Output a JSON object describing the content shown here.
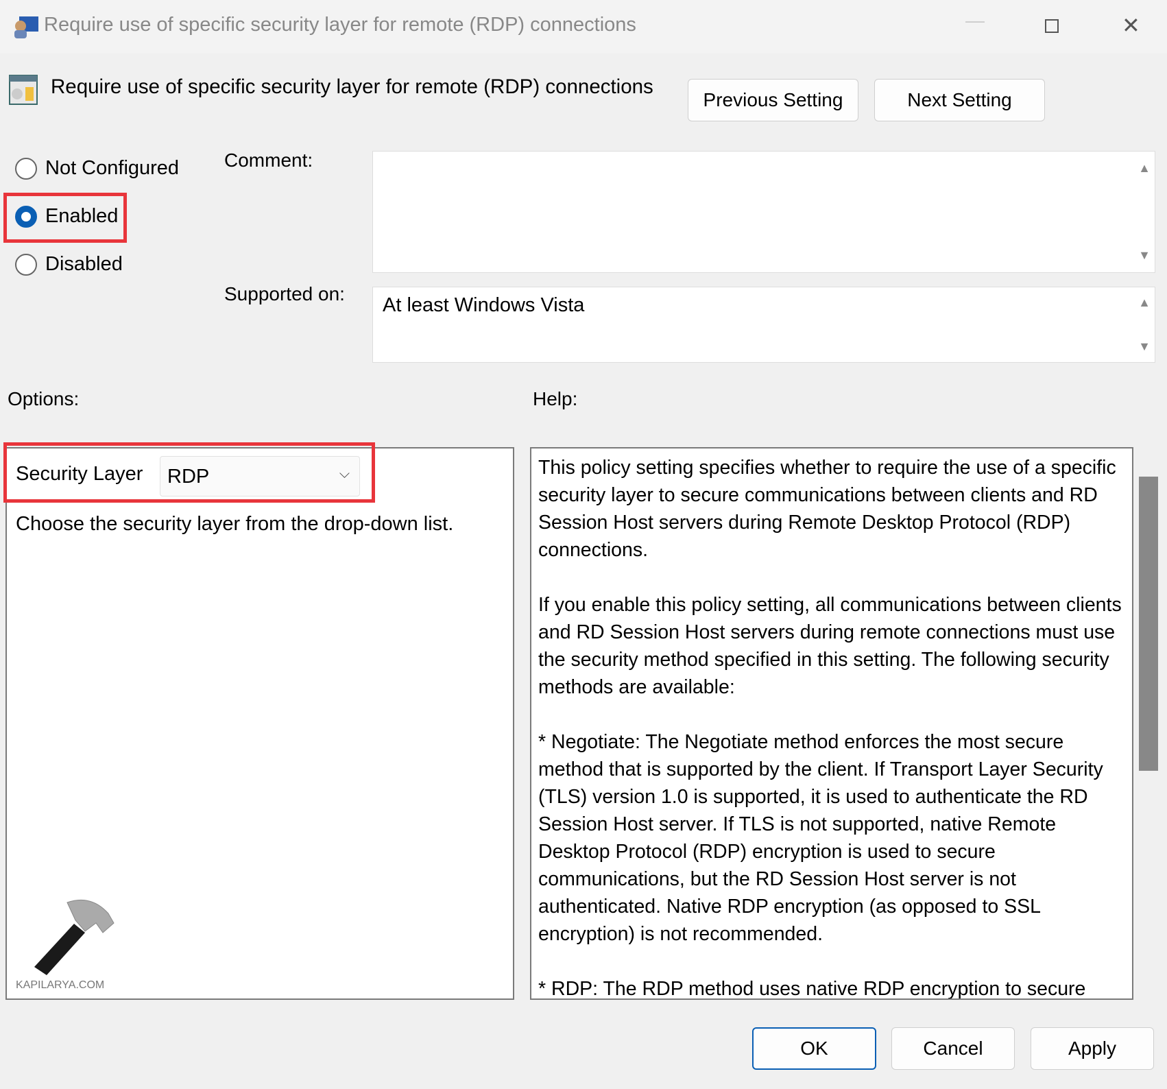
{
  "window": {
    "title": "Require use of specific security layer for remote (RDP) connections",
    "minimize_icon": "minimize-icon",
    "maximize_icon": "maximize-icon",
    "close_icon": "close-icon"
  },
  "header": {
    "title": "Require use of specific security layer for remote (RDP) connections",
    "previous_label": "Previous Setting",
    "next_label": "Next Setting"
  },
  "state": {
    "options": [
      {
        "label": "Not Configured",
        "selected": false
      },
      {
        "label": "Enabled",
        "selected": true
      },
      {
        "label": "Disabled",
        "selected": false
      }
    ]
  },
  "comment": {
    "label": "Comment:",
    "value": ""
  },
  "supported": {
    "label": "Supported on:",
    "value": "At least Windows Vista"
  },
  "options": {
    "label": "Options:",
    "security_layer_label": "Security Layer",
    "security_layer_value": "RDP",
    "description": "Choose the security layer from the drop-down list."
  },
  "help": {
    "label": "Help:",
    "paragraphs": [
      "This policy setting specifies whether to require the use of a specific security layer to secure communications between clients and RD Session Host servers during Remote Desktop Protocol (RDP) connections.",
      "If you enable this policy setting, all communications between clients and RD Session Host servers during remote connections must use the security method specified in this setting. The following security methods are available:",
      "* Negotiate: The Negotiate method enforces the most secure method that is supported by the client. If Transport Layer Security (TLS) version 1.0 is supported, it is used to authenticate the RD Session Host server. If TLS is not supported, native Remote Desktop Protocol (RDP) encryption is used to secure communications, but the RD Session Host server is not authenticated. Native RDP encryption (as opposed to SSL encryption) is not recommended.",
      "* RDP: The RDP method uses native RDP encryption to secure communications between the client and RD Session Host server. If"
    ]
  },
  "watermark": {
    "text": "KAPILARYA.COM"
  },
  "footer": {
    "ok": "OK",
    "cancel": "Cancel",
    "apply": "Apply"
  },
  "colors": {
    "accent": "#0a5fb4",
    "highlight": "#e8353b"
  }
}
